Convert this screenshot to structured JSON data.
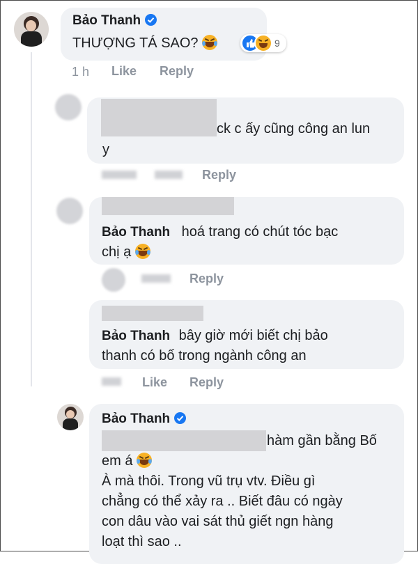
{
  "comments": {
    "c1": {
      "author": "Bảo Thanh",
      "text": "THƯỢNG TÁ SAO?",
      "reaction_count": "9",
      "time": "1 h",
      "like": "Like",
      "reply": "Reply"
    },
    "c2": {
      "text_line1": "ck c ấy cũng công an lun",
      "text_line2": "y",
      "reply": "Reply"
    },
    "c3": {
      "author": "Bảo Thanh",
      "text_line1": "hoá trang có chút tóc bạc",
      "text_line2": "chị ạ",
      "reply": "Reply"
    },
    "c4": {
      "author": "Bảo Thanh",
      "text_line1": "bây giờ mới biết chị bảo",
      "text_line2": "thanh có bố trong ngành công an",
      "like": "Like",
      "reply": "Reply"
    },
    "c5": {
      "author": "Bảo Thanh",
      "line1": "hàm gần bằng Bố",
      "line2": "em á",
      "line3": "À mà thôi. Trong vũ trụ vtv. Điều gì",
      "line4": "chẳng có thể xảy ra .. Biết đâu có ngày",
      "line5": "con dâu vào vai sát thủ giết ngn hàng",
      "line6": "loạt thì sao .."
    }
  },
  "colors": {
    "bubble": "#f0f2f5",
    "verified": "#1877f2",
    "muted": "#8d949e"
  }
}
